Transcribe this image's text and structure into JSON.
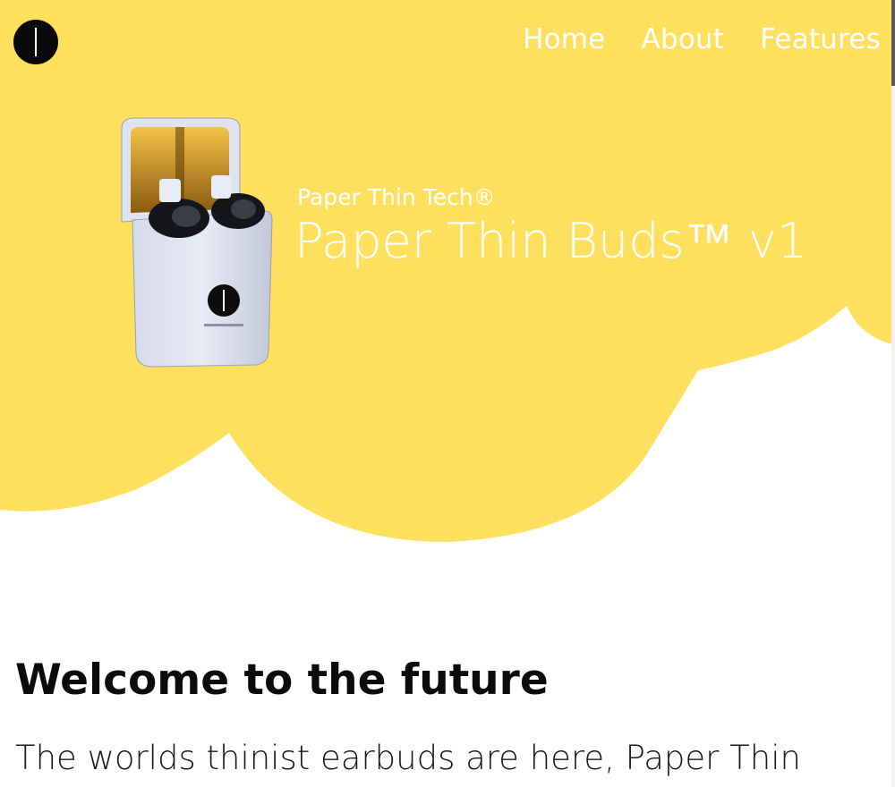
{
  "colors": {
    "hero_yellow": "#FEDF5E",
    "text_white": "#FFFFFF",
    "text_dark": "#0B0B0B",
    "logo_black": "#0A0A0A"
  },
  "header": {
    "logo_icon": "circle-line-logo-icon",
    "nav": {
      "home": "Home",
      "about": "About",
      "features": "Features"
    }
  },
  "hero": {
    "product_image": "earbuds-charging-case-image",
    "brand": "Paper Thin Tech®",
    "title": "Paper Thin Buds™ v1"
  },
  "main": {
    "heading": "Welcome to the future",
    "tagline": "The worlds thinist earbuds are here, Paper Thin"
  }
}
